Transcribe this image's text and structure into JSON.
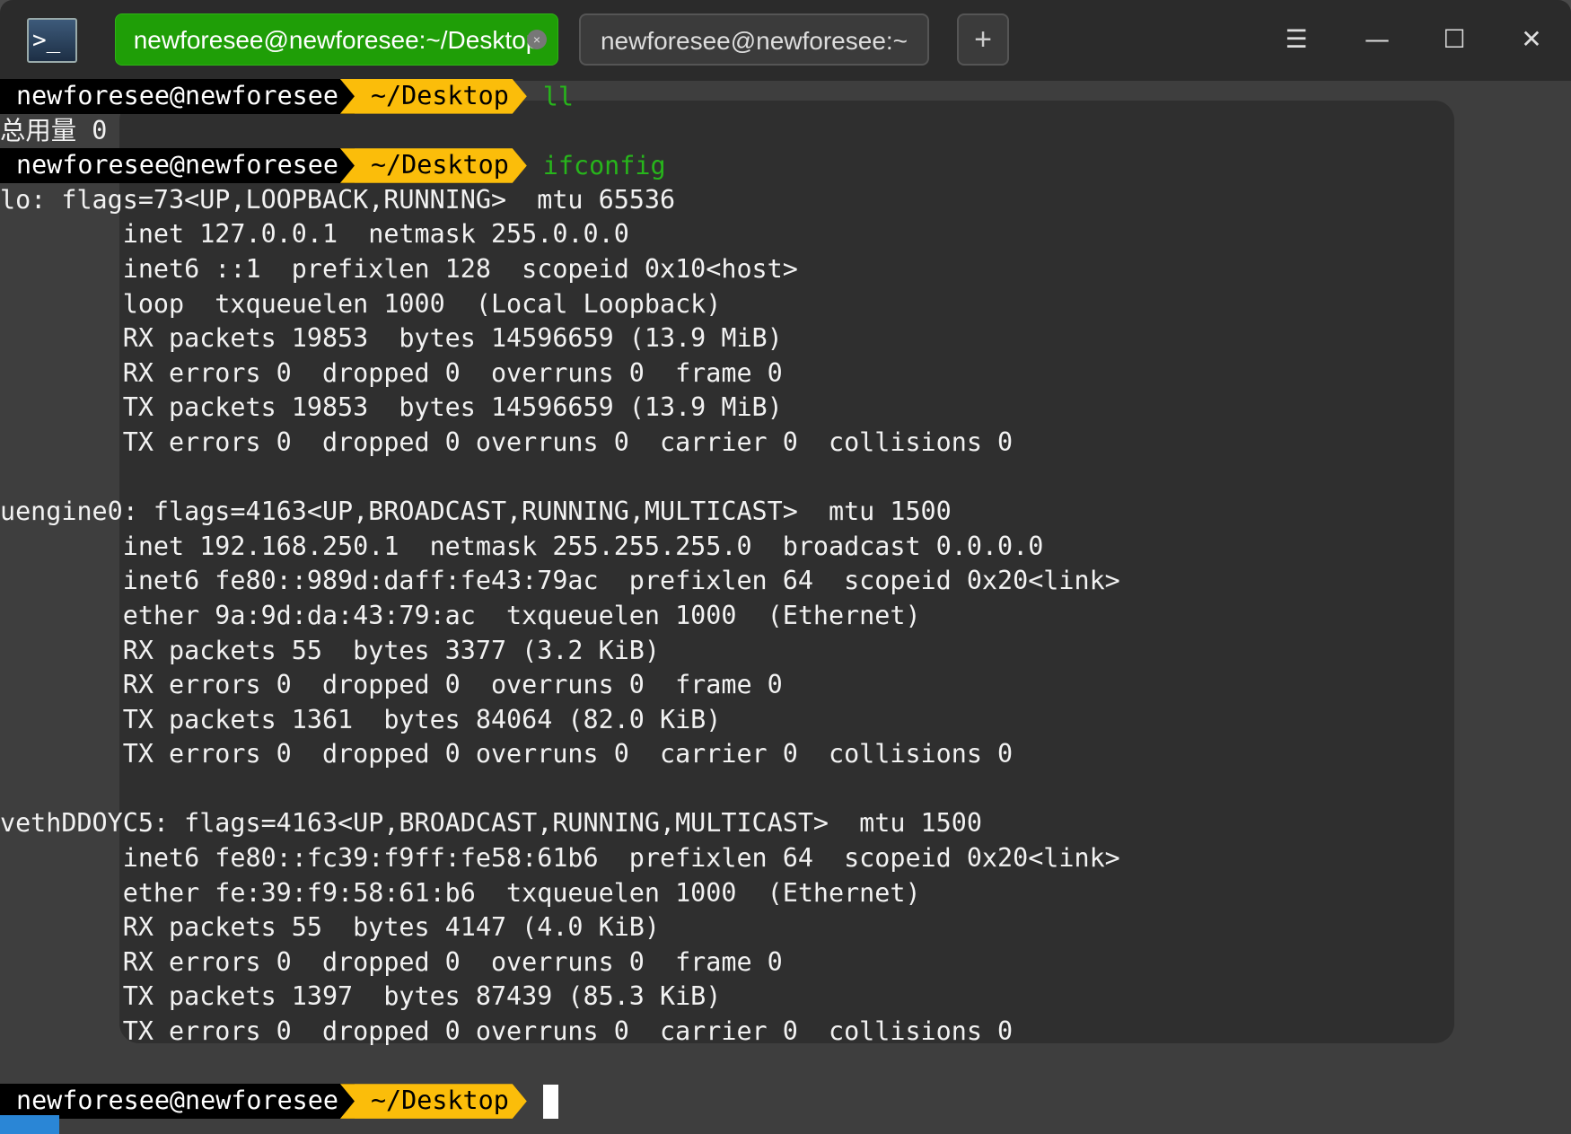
{
  "titlebar": {
    "tabs": [
      {
        "label": "newforesee@newforesee:~/Desktop",
        "active": true,
        "close": "×"
      },
      {
        "label": "newforesee@newforesee:~",
        "active": false
      }
    ],
    "new_tab": "+",
    "menu": "☰",
    "minimize": "—",
    "maximize": "☐",
    "close": "✕",
    "app_icon": ">_"
  },
  "prompt": {
    "user": "newforesee@newforesee",
    "dir": "~/Desktop"
  },
  "session": [
    {
      "type": "prompt",
      "cmd": "ll"
    },
    {
      "type": "out",
      "text": "总用量 0"
    },
    {
      "type": "prompt",
      "cmd": "ifconfig"
    },
    {
      "type": "out",
      "text": "lo: flags=73<UP,LOOPBACK,RUNNING>  mtu 65536"
    },
    {
      "type": "out",
      "text": "        inet 127.0.0.1  netmask 255.0.0.0"
    },
    {
      "type": "out",
      "text": "        inet6 ::1  prefixlen 128  scopeid 0x10<host>"
    },
    {
      "type": "out",
      "text": "        loop  txqueuelen 1000  (Local Loopback)"
    },
    {
      "type": "out",
      "text": "        RX packets 19853  bytes 14596659 (13.9 MiB)"
    },
    {
      "type": "out",
      "text": "        RX errors 0  dropped 0  overruns 0  frame 0"
    },
    {
      "type": "out",
      "text": "        TX packets 19853  bytes 14596659 (13.9 MiB)"
    },
    {
      "type": "out",
      "text": "        TX errors 0  dropped 0 overruns 0  carrier 0  collisions 0"
    },
    {
      "type": "out",
      "text": ""
    },
    {
      "type": "out",
      "text": "uengine0: flags=4163<UP,BROADCAST,RUNNING,MULTICAST>  mtu 1500"
    },
    {
      "type": "out",
      "text": "        inet 192.168.250.1  netmask 255.255.255.0  broadcast 0.0.0.0"
    },
    {
      "type": "out",
      "text": "        inet6 fe80::989d:daff:fe43:79ac  prefixlen 64  scopeid 0x20<link>"
    },
    {
      "type": "out",
      "text": "        ether 9a:9d:da:43:79:ac  txqueuelen 1000  (Ethernet)"
    },
    {
      "type": "out",
      "text": "        RX packets 55  bytes 3377 (3.2 KiB)"
    },
    {
      "type": "out",
      "text": "        RX errors 0  dropped 0  overruns 0  frame 0"
    },
    {
      "type": "out",
      "text": "        TX packets 1361  bytes 84064 (82.0 KiB)"
    },
    {
      "type": "out",
      "text": "        TX errors 0  dropped 0 overruns 0  carrier 0  collisions 0"
    },
    {
      "type": "out",
      "text": ""
    },
    {
      "type": "out",
      "text": "vethDDOYC5: flags=4163<UP,BROADCAST,RUNNING,MULTICAST>  mtu 1500"
    },
    {
      "type": "out",
      "text": "        inet6 fe80::fc39:f9ff:fe58:61b6  prefixlen 64  scopeid 0x20<link>"
    },
    {
      "type": "out",
      "text": "        ether fe:39:f9:58:61:b6  txqueuelen 1000  (Ethernet)"
    },
    {
      "type": "out",
      "text": "        RX packets 55  bytes 4147 (4.0 KiB)"
    },
    {
      "type": "out",
      "text": "        RX errors 0  dropped 0  overruns 0  frame 0"
    },
    {
      "type": "out",
      "text": "        TX packets 1397  bytes 87439 (85.3 KiB)"
    },
    {
      "type": "out",
      "text": "        TX errors 0  dropped 0 overruns 0  carrier 0  collisions 0"
    },
    {
      "type": "out",
      "text": ""
    },
    {
      "type": "prompt",
      "cmd": "",
      "cursor": true
    }
  ]
}
